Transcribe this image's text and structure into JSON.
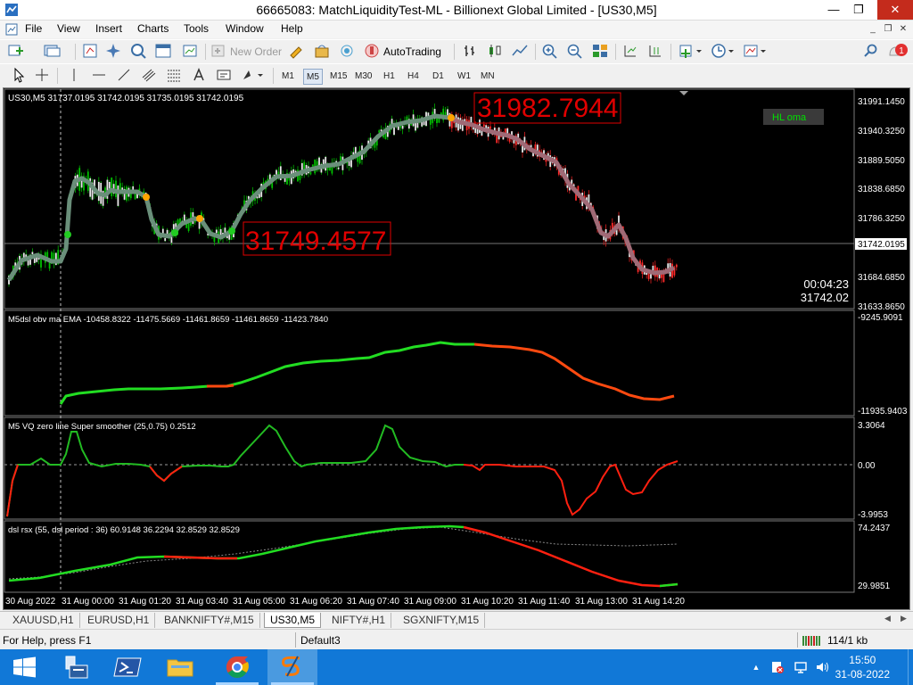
{
  "window": {
    "title": "66665083: MatchLiquidityTest-ML - Billionext Global Limited - [US30,M5]",
    "minimize_glyph": "—",
    "restore_glyph": "❐",
    "close_glyph": "✕"
  },
  "menu": {
    "items": [
      "File",
      "View",
      "Insert",
      "Charts",
      "Tools",
      "Window",
      "Help"
    ],
    "mdi_minimize": "_",
    "mdi_restore": "❐",
    "mdi_close": "✕"
  },
  "toolbar": {
    "new_order_label": "New Order",
    "autotrading_label": "AutoTrading",
    "notification_count": "1",
    "timeframes": [
      "M1",
      "M5",
      "M15",
      "M30",
      "H1",
      "H4",
      "D1",
      "W1",
      "MN"
    ],
    "active_timeframe": "M5"
  },
  "chart": {
    "main_header": "US30,M5  31737.0195 31742.0195 31735.0195 31742.0195",
    "indicator_label": "HL oma",
    "marker_high": "31982.7944",
    "marker_low": "31749.4577",
    "countdown": "00:04:23",
    "last_price_text": "31742.02",
    "current_price_tag": "31742.0195",
    "main_axis_labels": [
      "31991.1450",
      "31940.3250",
      "31889.5050",
      "31838.6850",
      "31786.3250",
      "31684.6850",
      "31633.8650"
    ],
    "panel2_header": "M5dsl  obv  ma  EMA  -10458.8322 -11475.5669 -11461.8659 -11461.8659 -11423.7840",
    "panel2_axis": [
      "-9245.9091",
      "-11935.9403"
    ],
    "panel3_header": "M5 VQ zero line Super smoother (25,0.75) 0.2512",
    "panel3_axis": [
      "3.3064",
      "0.00",
      "-3.9953"
    ],
    "panel4_header": "dsl rsx (55, dsl period : 36) 60.9148 36.2294 32.8529 32.8529",
    "panel4_axis": [
      "74.2437",
      "29.9851"
    ],
    "time_axis": [
      "30 Aug 2022",
      "31 Aug 00:00",
      "31 Aug 01:20",
      "31 Aug 03:40",
      "31 Aug 05:00",
      "31 Aug 06:20",
      "31 Aug 07:40",
      "31 Aug 09:00",
      "31 Aug 10:20",
      "31 Aug 11:40",
      "31 Aug 13:00",
      "31 Aug 14:20"
    ]
  },
  "symbol_tabs": [
    "XAUUSD,H1",
    "EURUSD,H1",
    "BANKNIFTY#,M15",
    "US30,M5",
    "NIFTY#,H1",
    "SGXNIFTY,M15"
  ],
  "active_symbol_tab": "US30,M5",
  "status": {
    "help_text": "For Help, press F1",
    "profile": "Default3",
    "traffic": "114/1 kb"
  },
  "taskbar": {
    "time": "15:50",
    "date": "31-08-2022"
  },
  "colors": {
    "bull": "#00e000",
    "bear": "#ff2000",
    "oma_up": "#6a8f7a",
    "oma_down": "#a0606a",
    "marker_red": "#e00000",
    "taskbar": "#1178d7"
  }
}
